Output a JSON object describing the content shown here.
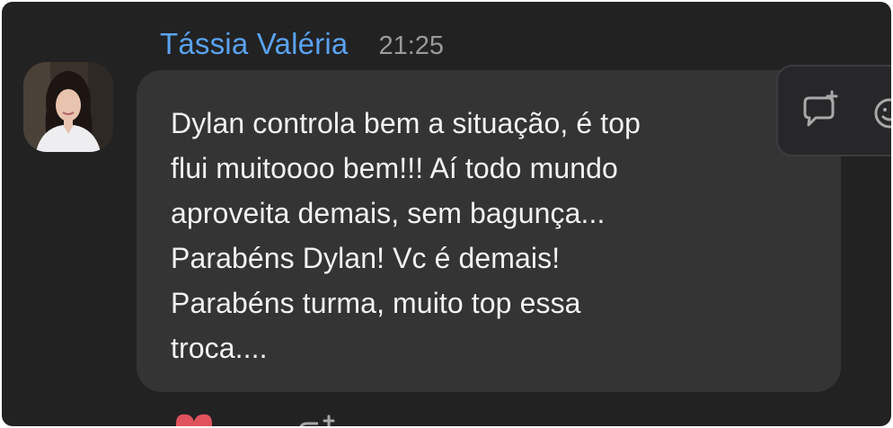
{
  "message": {
    "sender": "Tássia Valéria",
    "time": "21:25",
    "text": "Dylan controla bem a situação, é top\nflui muitoooo bem!!! Aí todo mundo\naproveita demais, sem bagunça...\nParabéns Dylan! Vc é demais!\nParabéns turma, muito top essa\ntroca...."
  },
  "hover_actions": {
    "icons": [
      "add-comment-icon",
      "add-reaction-icon"
    ]
  },
  "reactions": {
    "icons": [
      "heart-icon",
      "add-comment-icon"
    ]
  },
  "colors": {
    "background": "#222223",
    "bubble": "#343435",
    "sender_name": "#5aa2f0",
    "timestamp": "#9a9a9a",
    "message_text": "#f2f2f2",
    "heart": "#e0525c"
  }
}
